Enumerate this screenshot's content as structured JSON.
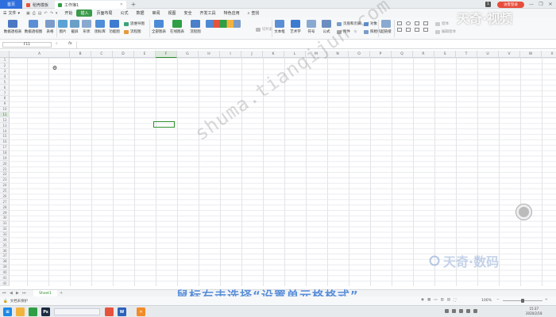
{
  "titlebar": {
    "home_tab": "首页",
    "tabs": [
      {
        "label": "稻壳模板",
        "icon_color": "#e5533d"
      },
      {
        "label": "工作簿1",
        "icon_color": "#2f9e44"
      }
    ],
    "new_tab_symbol": "+",
    "badge_number": "1",
    "login_label": "访客登录",
    "win_minimize": "—",
    "win_maximize": "❐",
    "win_close": "✕"
  },
  "menu": {
    "file_label": "文件",
    "items": [
      "开始",
      "插入",
      "页面布局",
      "公式",
      "数据",
      "审阅",
      "视图",
      "安全",
      "开发工具",
      "特色应用"
    ],
    "active_item": "插入",
    "search_label": "查找"
  },
  "ribbon": {
    "large_buttons": [
      "数据透视表",
      "数据透视图",
      "表格",
      "图片",
      "截屏",
      "形状",
      "图标库",
      "功能图",
      "全部图表",
      "在线图表",
      "流程图",
      "文本框",
      "艺术字",
      "符号",
      "公式",
      "超链接"
    ],
    "small_buttons": [
      "思维导图",
      "流程图",
      "切片器",
      "页眉和页脚",
      "附件",
      "对象",
      "照相机",
      "窗体",
      "编辑窗体"
    ]
  },
  "formula_bar": {
    "name_box": "F11",
    "fx_label": "fx",
    "value": ""
  },
  "grid": {
    "columns": [
      "A",
      "B",
      "C",
      "D",
      "E",
      "F",
      "G",
      "H",
      "I",
      "J",
      "K",
      "L",
      "M",
      "N",
      "O",
      "P",
      "Q",
      "R",
      "S",
      "T",
      "U",
      "V",
      "W",
      "X"
    ],
    "selected_column": "F",
    "rows": [
      "1",
      "2",
      "3",
      "4",
      "5",
      "6",
      "7",
      "8",
      "9",
      "10",
      "11",
      "12",
      "13",
      "14",
      "15",
      "16",
      "17",
      "18",
      "19",
      "20",
      "21",
      "22",
      "23",
      "24",
      "25",
      "26",
      "27",
      "28",
      "29",
      "30",
      "31",
      "32",
      "33",
      "34",
      "35",
      "36",
      "37",
      "38",
      "39",
      "40",
      "41",
      "42"
    ],
    "selected_row": "11",
    "active_cell": "F11"
  },
  "sheets": {
    "tabs": [
      "Sheet1"
    ],
    "add_symbol": "+"
  },
  "status": {
    "left_text": "文档未保护",
    "zoom": "100%"
  },
  "overlay": {
    "watermark": "shuma.tianqijun.com",
    "brand_top": "天奇·视频",
    "brand_bottom": "天奇·数码",
    "subtitle": "鼠标右击选择“设置单元格格式”"
  },
  "taskbar": {
    "time": "15:37",
    "date": "2020/2/18",
    "apps": [
      {
        "name": "start",
        "color": "#1e88e5",
        "glyph": "⊞"
      },
      {
        "name": "file-explorer",
        "color": "#f2b33d",
        "glyph": ""
      },
      {
        "name": "browser",
        "color": "#2f9e44",
        "glyph": ""
      },
      {
        "name": "photoshop",
        "color": "#1b2a40",
        "glyph": "Ps"
      },
      {
        "name": "wps-spreadsheet",
        "color": "#e5533d",
        "glyph": ""
      },
      {
        "name": "word",
        "color": "#2b62b8",
        "glyph": "W"
      },
      {
        "name": "tool",
        "color": "#f28c28",
        "glyph": "✕"
      }
    ]
  },
  "colors": {
    "accent_green": "#2f9e44",
    "home_blue": "#2f6fdd",
    "subtitle_blue": "#5b8fd8",
    "login_red": "#e74c3c"
  }
}
